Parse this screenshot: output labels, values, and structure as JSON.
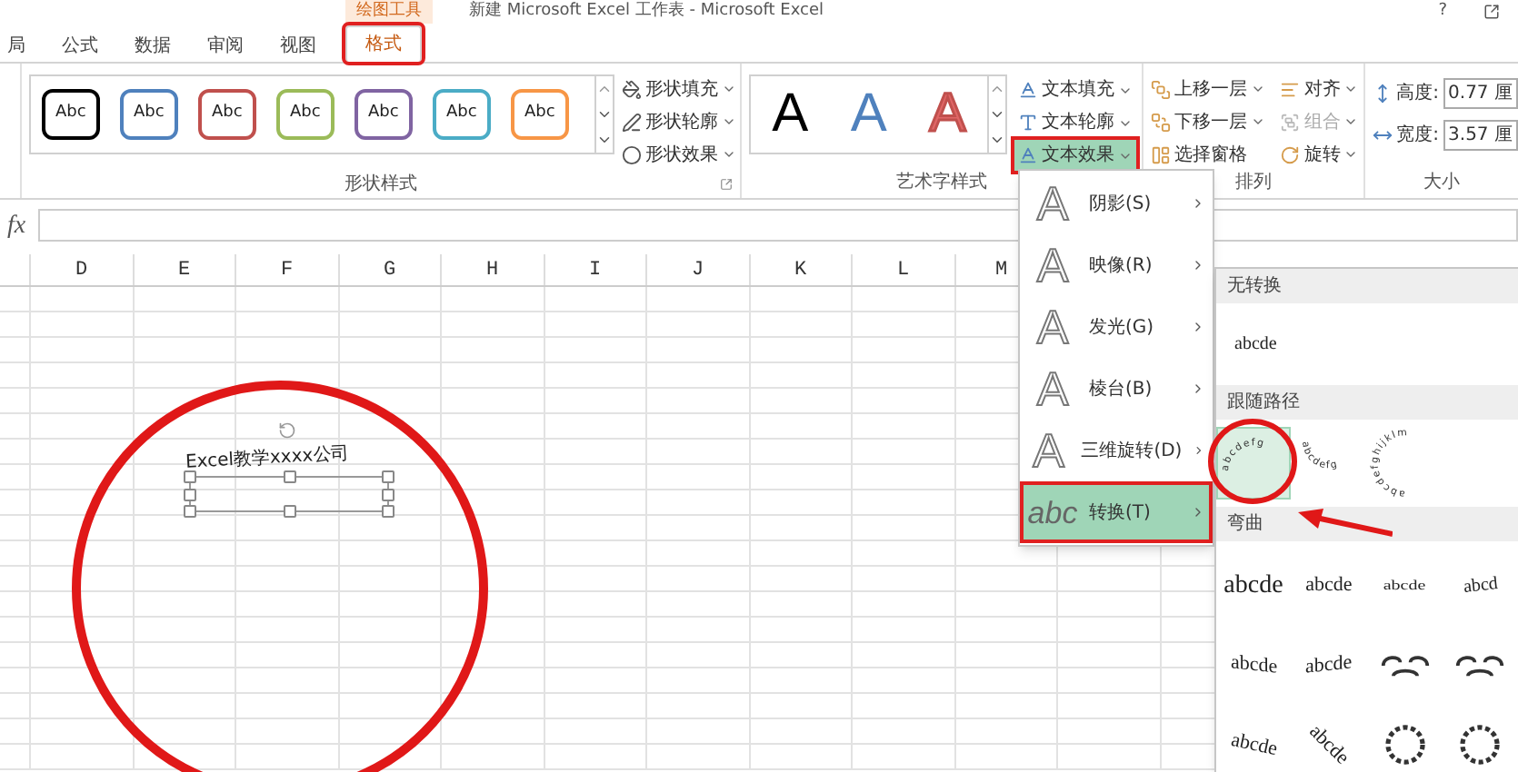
{
  "title_bar": {
    "context_label": "绘图工具",
    "title": "新建 Microsoft Excel 工作表 - Microsoft Excel",
    "help": "?"
  },
  "tabs": [
    {
      "label": "局",
      "selected": false
    },
    {
      "label": "公式",
      "selected": false
    },
    {
      "label": "数据",
      "selected": false
    },
    {
      "label": "审阅",
      "selected": false
    },
    {
      "label": "视图",
      "selected": false
    },
    {
      "label": "格式",
      "selected": true
    }
  ],
  "shape_styles": {
    "label": "形状样式",
    "presets": [
      {
        "text": "Abc",
        "color": "#000000"
      },
      {
        "text": "Abc",
        "color": "#4f81bd"
      },
      {
        "text": "Abc",
        "color": "#c0504d"
      },
      {
        "text": "Abc",
        "color": "#9bbb59"
      },
      {
        "text": "Abc",
        "color": "#8064a2"
      },
      {
        "text": "Abc",
        "color": "#4bacc6"
      },
      {
        "text": "Abc",
        "color": "#f79646"
      }
    ],
    "buttons": [
      {
        "label": "形状填充",
        "kind": "fill"
      },
      {
        "label": "形状轮廓",
        "kind": "outline"
      },
      {
        "label": "形状效果",
        "kind": "effect"
      }
    ]
  },
  "wordart_styles": {
    "label": "艺术字样式",
    "presets": [
      {
        "text": "A",
        "kind": "solid",
        "color": "#000000"
      },
      {
        "text": "A",
        "kind": "solid",
        "color": "#4f81bd"
      },
      {
        "text": "A",
        "kind": "outlined",
        "color": "#e06666"
      }
    ],
    "buttons": [
      {
        "label": "文本填充",
        "kind": "fill",
        "selected": false
      },
      {
        "label": "文本轮廓",
        "kind": "outline",
        "selected": false
      },
      {
        "label": "文本效果",
        "kind": "effect",
        "selected": true
      }
    ]
  },
  "arrange": {
    "label": "排列",
    "buttons": [
      {
        "label": "上移一层",
        "kind": "front",
        "disabled": false
      },
      {
        "label": "下移一层",
        "kind": "back",
        "disabled": false
      },
      {
        "label": "选择窗格",
        "kind": "pane",
        "disabled": false
      },
      {
        "label": "对齐",
        "kind": "align",
        "disabled": false
      },
      {
        "label": "组合",
        "kind": "group",
        "disabled": true
      },
      {
        "label": "旋转",
        "kind": "rotate",
        "disabled": false
      }
    ]
  },
  "size": {
    "label": "大小",
    "fields": [
      {
        "label": "高度:",
        "value": "0.77 厘",
        "kind": "height"
      },
      {
        "label": "宽度:",
        "value": "3.57 厘",
        "kind": "width"
      }
    ]
  },
  "formula_bar": {
    "function_label": "fx"
  },
  "columns": [
    "D",
    "E",
    "F",
    "G",
    "H",
    "I",
    "J",
    "K",
    "L",
    "M"
  ],
  "text_box": {
    "text": "Excel教学xxxx公司"
  },
  "effects_menu": {
    "items": [
      {
        "label": "阴影(S)",
        "icon_text": "A",
        "selected": false
      },
      {
        "label": "映像(R)",
        "icon_text": "A",
        "selected": false
      },
      {
        "label": "发光(G)",
        "icon_text": "A",
        "selected": false
      },
      {
        "label": "棱台(B)",
        "icon_text": "A",
        "selected": false
      },
      {
        "label": "三维旋转(D)",
        "icon_text": "A",
        "selected": false
      },
      {
        "label": "转换(T)",
        "icon_text": "abc",
        "selected": true
      }
    ]
  },
  "transform_gallery": {
    "sections": [
      {
        "title": "无转换",
        "items": [
          {
            "kind": "plain",
            "text": "abcde",
            "selected": false
          }
        ]
      },
      {
        "title": "跟随路径",
        "items": [
          {
            "kind": "arch-up",
            "text": "abcdefg",
            "selected": true
          },
          {
            "kind": "arch-down",
            "text": "abcdefg",
            "selected": false
          },
          {
            "kind": "circle",
            "text": "abcdefghijklm",
            "selected": false
          }
        ]
      },
      {
        "title": "弯曲",
        "items": [
          {
            "kind": "big",
            "text": "abcde",
            "selected": false
          },
          {
            "kind": "small",
            "text": "abcde",
            "selected": false
          },
          {
            "kind": "triangle",
            "text": "abcde",
            "selected": false
          },
          {
            "kind": "rise",
            "text": "abcd",
            "selected": false
          },
          {
            "kind": "wave",
            "text": "abcde",
            "selected": false
          },
          {
            "kind": "dip",
            "text": "abcde",
            "selected": false
          },
          {
            "kind": "pour",
            "selected": false
          },
          {
            "kind": "pour",
            "selected": false
          },
          {
            "kind": "arc",
            "text": "abcde",
            "selected": false
          },
          {
            "kind": "slant",
            "text": "abcde",
            "selected": false
          },
          {
            "kind": "ring",
            "selected": false
          },
          {
            "kind": "ring",
            "selected": false
          }
        ]
      }
    ]
  }
}
